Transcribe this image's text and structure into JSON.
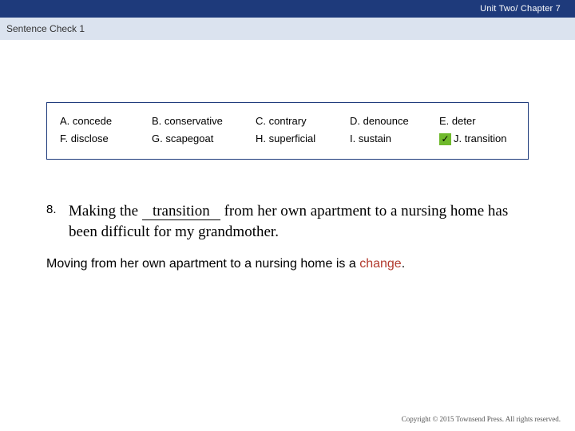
{
  "header": {
    "unit_chapter": "Unit Two/ Chapter 7",
    "section": "Sentence Check 1"
  },
  "wordbank": {
    "row1": {
      "a": "A. concede",
      "b": "B. conservative",
      "c": "C. contrary",
      "d": "D. denounce",
      "e": "E. deter"
    },
    "row2": {
      "f": "F. disclose",
      "g": "G. scapegoat",
      "h": "H. superficial",
      "i": "I.   sustain",
      "j": "J. transition"
    },
    "checkmark_glyph": "✓"
  },
  "question": {
    "number": "8.",
    "prefix": "Making the ",
    "blank_value": "transition",
    "suffix": " from her own apartment to a nursing home has been difficult for my grandmother."
  },
  "explanation": {
    "before": "Moving from her own apartment to a nursing home is a ",
    "keyword": "change",
    "after": "."
  },
  "footer": {
    "copyright": "Copyright © 2015 Townsend Press. All rights reserved."
  }
}
